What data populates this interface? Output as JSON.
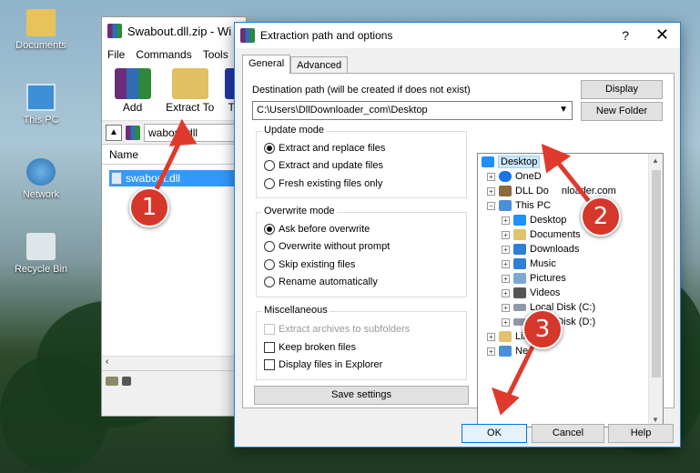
{
  "desktop": {
    "icons": [
      {
        "label": "Documents",
        "icon": "folder-documents-icon"
      },
      {
        "label": "This PC",
        "icon": "computer-icon"
      },
      {
        "label": "Network",
        "icon": "network-icon"
      },
      {
        "label": "Recycle Bin",
        "icon": "recycle-bin-icon"
      }
    ]
  },
  "winrar": {
    "title": "Swabout.dll.zip - Wi",
    "menu": [
      "File",
      "Commands",
      "Tools"
    ],
    "toolbar": {
      "add": "Add",
      "extract_to": "Extract To",
      "more": "T"
    },
    "address": "wabout.dll",
    "list_header": "Name",
    "file": "swabout.dll"
  },
  "dialog": {
    "title": "Extraction path and options",
    "help": "?",
    "close": "✕",
    "tabs": [
      "General",
      "Advanced"
    ],
    "dest_label": "Destination path (will be created if does not exist)",
    "dest_value": "C:\\Users\\DllDownloader_com\\Desktop",
    "display_btn": "Display",
    "new_folder_btn": "New Folder",
    "update_mode": {
      "title": "Update mode",
      "options": [
        "Extract and replace files",
        "Extract and update files",
        "Fresh existing files only"
      ],
      "selected": 0
    },
    "overwrite_mode": {
      "title": "Overwrite mode",
      "options": [
        "Ask before overwrite",
        "Overwrite without prompt",
        "Skip existing files",
        "Rename automatically"
      ],
      "selected": 0
    },
    "misc": {
      "title": "Miscellaneous",
      "options": [
        "Extract archives to subfolders",
        "Keep broken files",
        "Display files in Explorer"
      ],
      "disabled": [
        true,
        false,
        false
      ],
      "checked": [
        false,
        false,
        false
      ]
    },
    "save_settings": "Save settings",
    "tree": [
      {
        "label": "Desktop",
        "icon": "desktop-icon",
        "color": "#1e90ff",
        "selected": true,
        "expander": ""
      },
      {
        "label": "OneD",
        "icon": "onedrive-icon",
        "color": "#1a73e8",
        "expander": "+"
      },
      {
        "label": "DLL Do",
        "label_tail": "nloader.com",
        "icon": "user-icon",
        "color": "#8a6b3c",
        "expander": "+"
      },
      {
        "label": "This PC",
        "icon": "computer-icon",
        "color": "#4a90d9",
        "expander": "−"
      },
      {
        "label": "Desktop",
        "icon": "desktop-icon",
        "color": "#1e90ff",
        "expander": "+"
      },
      {
        "label": "Documents",
        "icon": "documents-icon",
        "color": "#e2c170",
        "expander": "+"
      },
      {
        "label": "Downloads",
        "icon": "downloads-icon",
        "color": "#2e7fd6",
        "expander": "+"
      },
      {
        "label": "Music",
        "icon": "music-icon",
        "color": "#2e7fd6",
        "expander": "+"
      },
      {
        "label": "Pictures",
        "icon": "pictures-icon",
        "color": "#7aa9d6",
        "expander": "+"
      },
      {
        "label": "Videos",
        "icon": "videos-icon",
        "color": "#555555",
        "expander": "+"
      },
      {
        "label": "Local Disk (C:)",
        "icon": "disk-c-icon",
        "color": "#8e9aa6",
        "expander": "+"
      },
      {
        "label": "Local Disk (D:)",
        "icon": "disk-d-icon",
        "color": "#8e9aa6",
        "expander": "+"
      },
      {
        "label": "Libr",
        "icon": "libraries-icon",
        "color": "#e2c170",
        "expander": "+"
      },
      {
        "label": "Ne",
        "icon": "network-icon",
        "color": "#4a90d9",
        "expander": "+"
      }
    ],
    "ok": "OK",
    "cancel": "Cancel",
    "help_btn": "Help"
  },
  "annotations": {
    "badges": [
      "1",
      "2",
      "3"
    ],
    "color": "#d5372b"
  }
}
